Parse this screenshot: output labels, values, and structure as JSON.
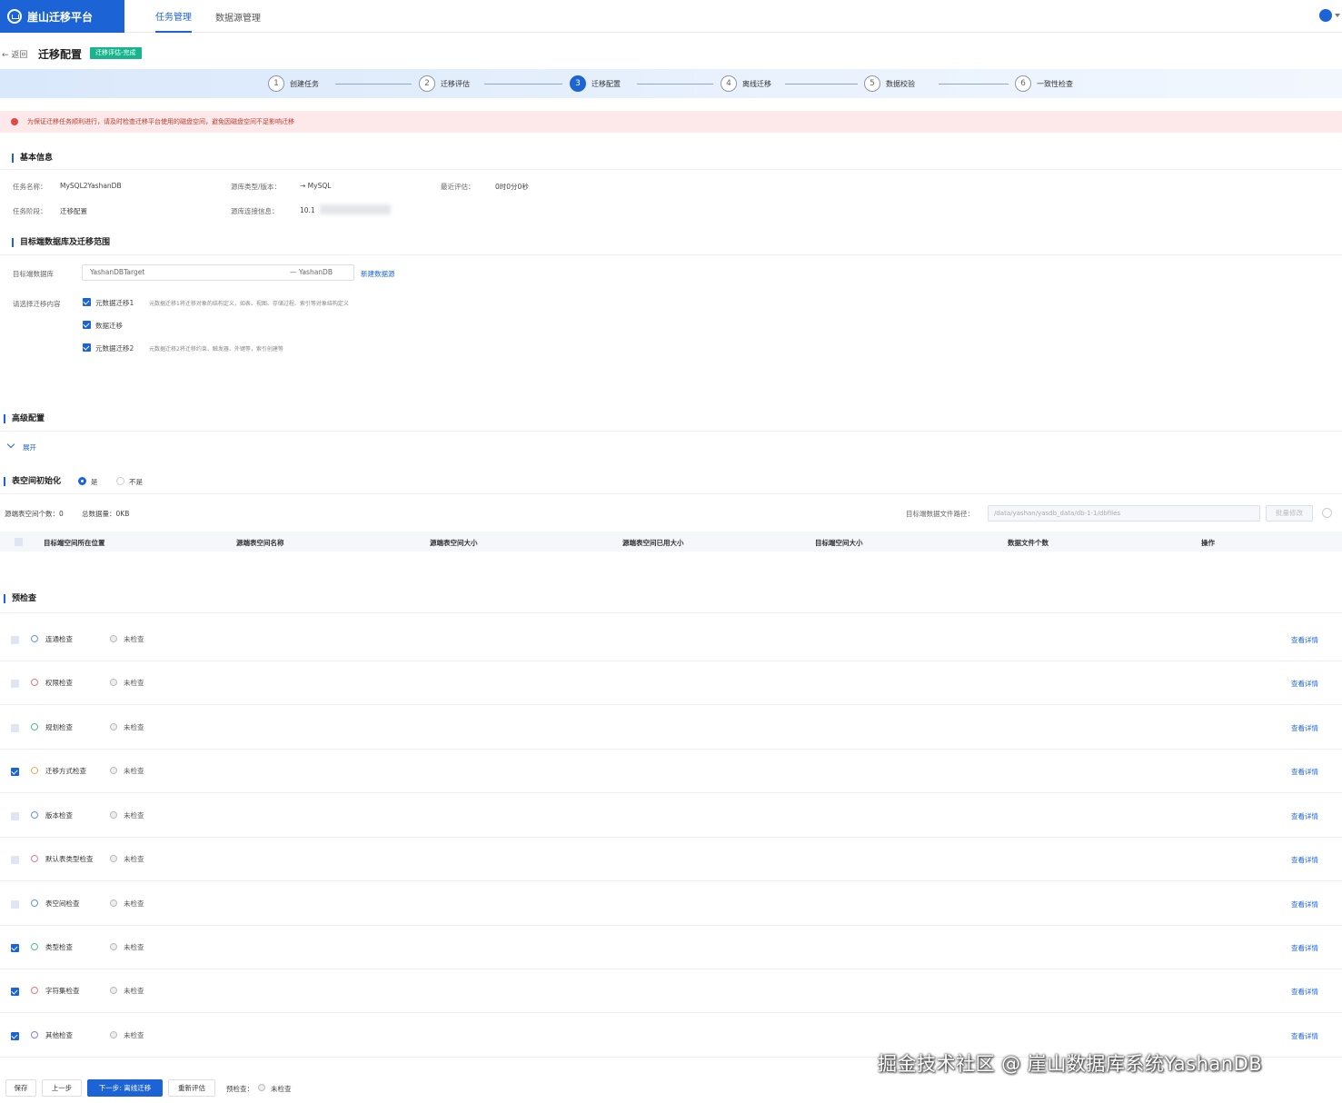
{
  "app": {
    "title": "崖山迁移平台"
  },
  "nav": {
    "tab1": "任务管理",
    "tab2": "数据源管理"
  },
  "header": {
    "back": "返回",
    "title": "迁移配置",
    "badge": "迁移评估-完成"
  },
  "steps": [
    {
      "num": "1",
      "label": "创建任务"
    },
    {
      "num": "2",
      "label": "迁移评估"
    },
    {
      "num": "3",
      "label": "迁移配置"
    },
    {
      "num": "4",
      "label": "离线迁移"
    },
    {
      "num": "5",
      "label": "数据校验"
    },
    {
      "num": "6",
      "label": "一致性检查"
    }
  ],
  "alert": {
    "text": "为保证迁移任务顺利进行，请及时检查迁移平台使用的磁盘空间，避免因磁盘空间不足影响迁移"
  },
  "basic": {
    "title": "基本信息",
    "task_name_label": "任务名称：",
    "task_name": "MySQL2YashanDB",
    "src_db_label": "源库类型/版本：",
    "src_db": "MySQL",
    "last_eval_label": "最近评估：",
    "last_eval": "0时0分0秒",
    "stage_label": "任务阶段：",
    "stage": "迁移配置",
    "src_conn_label": "源库连接信息：",
    "src_conn": "10.1"
  },
  "target": {
    "title": "目标端数据库及迁移范围",
    "db_label": "目标端数据库",
    "db_value": "YashanDBTarget",
    "db_type": "YashanDB",
    "add_link": "新建数据源",
    "content_label": "请选择迁移内容",
    "opt1": "元数据迁移1",
    "opt1_desc": "元数据迁移1将迁移对象的结构定义，如表、视图、存储过程、索引等对象结构定义",
    "opt2": "数据迁移",
    "opt3": "元数据迁移2",
    "opt3_desc": "元数据迁移2将迁移约束、触发器、外键等，索引创建等"
  },
  "advanced": {
    "title": "高级配置",
    "expand": "展开"
  },
  "tablespace": {
    "title": "表空间初始化",
    "opt_yes": "是",
    "opt_no": "不是",
    "count_label": "源端表空间个数：0",
    "size_label": "总数据量：0KB",
    "path_label": "目标端数据文件路径：",
    "path_placeholder": "/data/yashan/yasdb_data/db-1-1/dbfiles",
    "btn": "批量修改",
    "headers": [
      "目标端空间所在位置",
      "源端表空间名称",
      "源端表空间大小",
      "源端表空间已用大小",
      "目标端空间大小",
      "数据文件个数",
      "操作"
    ]
  },
  "precheck": {
    "title": "预检查",
    "detail": "查看详情",
    "items": [
      {
        "name": "连通检查",
        "status": "未检查"
      },
      {
        "name": "权限检查",
        "status": "未检查"
      },
      {
        "name": "规划检查",
        "status": "未检查"
      },
      {
        "name": "迁移方式检查",
        "status": "未检查"
      },
      {
        "name": "版本检查",
        "status": "未检查"
      },
      {
        "name": "默认表类型检查",
        "status": "未检查"
      },
      {
        "name": "表空间检查",
        "status": "未检查"
      },
      {
        "name": "类型检查",
        "status": "未检查"
      },
      {
        "name": "字符集检查",
        "status": "未检查"
      },
      {
        "name": "其他检查",
        "status": "未检查"
      }
    ]
  },
  "footer": {
    "save": "保存",
    "prev": "上一步",
    "next": "下一步: 离线迁移",
    "reeval": "重新评估",
    "precheck_label": "预检查：",
    "precheck_status": "未检查"
  },
  "watermark": "掘金技术社区 @ 崖山数据库系统YashanDB",
  "colors": {
    "primary": "#1c64d6",
    "success": "#18b58d",
    "alert_bg": "#fde8ea"
  }
}
